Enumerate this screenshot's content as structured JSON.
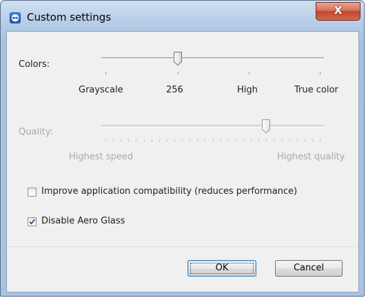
{
  "window": {
    "title": "Custom settings",
    "close_label": "X"
  },
  "colors": {
    "label": "Colors:",
    "options": [
      "Grayscale",
      "256",
      "High",
      "True color"
    ],
    "selected": "256"
  },
  "quality": {
    "label": "Quality:",
    "min_label": "Highest speed",
    "max_label": "Highest quality",
    "level": 0.74,
    "enabled": false
  },
  "options": {
    "compatibility": {
      "label": "Improve application compatibility (reduces performance)",
      "checked": false
    },
    "aero": {
      "label": "Disable Aero Glass",
      "checked": true
    }
  },
  "buttons": {
    "ok": "OK",
    "cancel": "Cancel"
  },
  "icons": {
    "app": "teamviewer-icon",
    "close": "close-icon",
    "check": "checkmark-icon"
  },
  "colors_theme": {
    "accent": "#3c7fb1",
    "title_bar": "#b9cfe8",
    "close": "#c3462d"
  }
}
